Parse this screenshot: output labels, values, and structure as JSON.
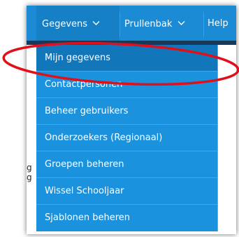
{
  "menubar": {
    "items": [
      {
        "label": "Gegevens",
        "icon": "chevron-down-icon"
      },
      {
        "label": "Prullenbak",
        "icon": "chevron-down-icon"
      },
      {
        "label": "Help"
      }
    ]
  },
  "dropdown": {
    "items": [
      {
        "label": "Mijn gegevens"
      },
      {
        "label": "Contactpersonen"
      },
      {
        "label": "Beheer gebruikers"
      },
      {
        "label": "Onderzoekers (Regionaal)"
      },
      {
        "label": "Groepen beheren"
      },
      {
        "label": "Wissel Schooljaar"
      },
      {
        "label": "Sjablonen beheren"
      }
    ]
  },
  "background_text": [
    "g",
    "g"
  ],
  "colors": {
    "menubar": "#1a8bd4",
    "dropdown": "#1b92de",
    "selected_item": "#1276ba",
    "annotation": "#e0101a"
  }
}
